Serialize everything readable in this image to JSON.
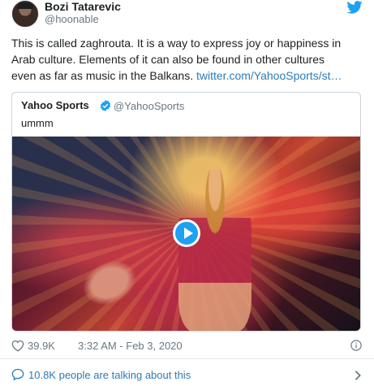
{
  "author": {
    "name": "Bozi Tatarevic",
    "handle": "@hoonable"
  },
  "tweet": {
    "text_line1": "This is called zaghrouta. It is a way to express joy or happiness in",
    "text_line2": "Arab culture. Elements of it can also be found in other cultures",
    "text_line3": "even as far as music in the Balkans. ",
    "link_text": "twitter.com/YahooSports/st…"
  },
  "quoted": {
    "name": "Yahoo Sports",
    "handle": "@YahooSports",
    "text": "ummm"
  },
  "footer": {
    "likes": "39.9K",
    "timestamp": "3:32 AM - Feb 3, 2020"
  },
  "conversation": {
    "label": "10.8K people are talking about this"
  },
  "colors": {
    "link": "#2b7bb9",
    "twitter_blue": "#1da1f2",
    "muted": "#697882"
  },
  "icons": [
    "twitter-bird-icon",
    "verified-badge-icon",
    "play-icon",
    "heart-icon",
    "info-icon",
    "speech-bubble-icon",
    "chevron-right-icon"
  ]
}
